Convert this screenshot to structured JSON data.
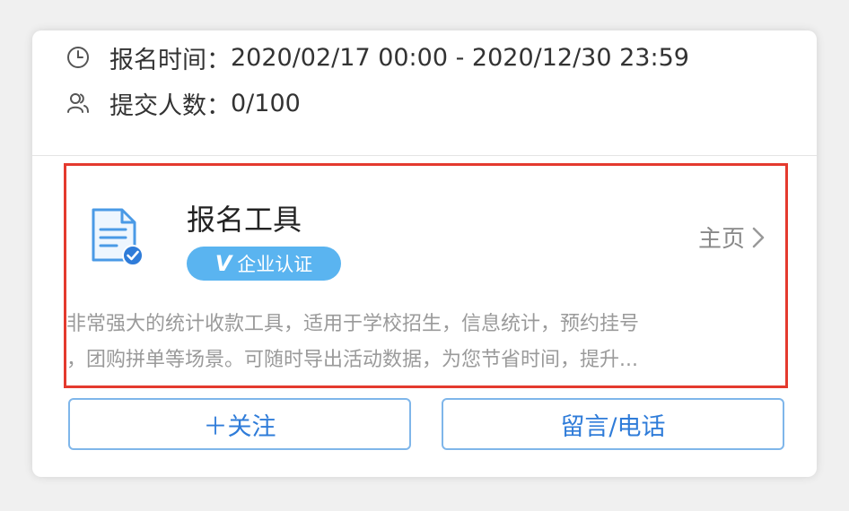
{
  "event": {
    "time_label": "报名时间：",
    "time_value": "2020/02/17 00:00 - 2020/12/30 23:59",
    "count_label": "提交人数：",
    "count_value": "0/100"
  },
  "tool": {
    "title": "报名工具",
    "badge_v": "V",
    "badge_text": "企业认证",
    "home_label": "主页",
    "description_lines": [
      "非常强大的统计收款工具，适用于学校招生，信息统计，预约挂号",
      "，团购拼单等场景。可随时导出活动数据，为您节省时间，提升..."
    ]
  },
  "actions": {
    "follow_label": "＋关注",
    "contact_label": "留言/电话"
  },
  "colors": {
    "accent": "#2f7cd9",
    "badge_bg": "#5ab4f0",
    "highlight_border": "#e43a2e"
  },
  "icons": {
    "clock": "clock-icon",
    "users": "users-icon",
    "document_verified": "document-check-icon",
    "chevron": "chevron-right-icon"
  }
}
